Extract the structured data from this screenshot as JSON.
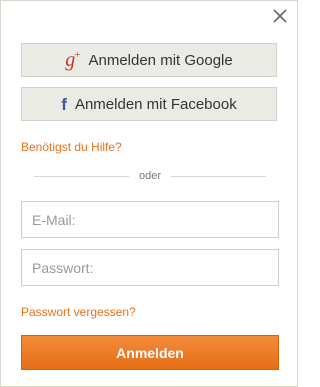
{
  "dialog": {
    "close_icon": "close-icon",
    "google_label": "Anmelden mit Google",
    "google_icon_text": "g",
    "google_icon_plus": "+",
    "facebook_label": "Anmelden mit Facebook",
    "facebook_icon_text": "f",
    "help_link": "Benötigst du Hilfe?",
    "divider_text": "oder",
    "email_placeholder": "E-Mail:",
    "password_placeholder": "Passwort:",
    "forgot_link": "Passwort vergessen?",
    "submit_label": "Anmelden"
  },
  "colors": {
    "accent": "#e8731e",
    "google": "#c0392b",
    "facebook": "#3b5998"
  }
}
